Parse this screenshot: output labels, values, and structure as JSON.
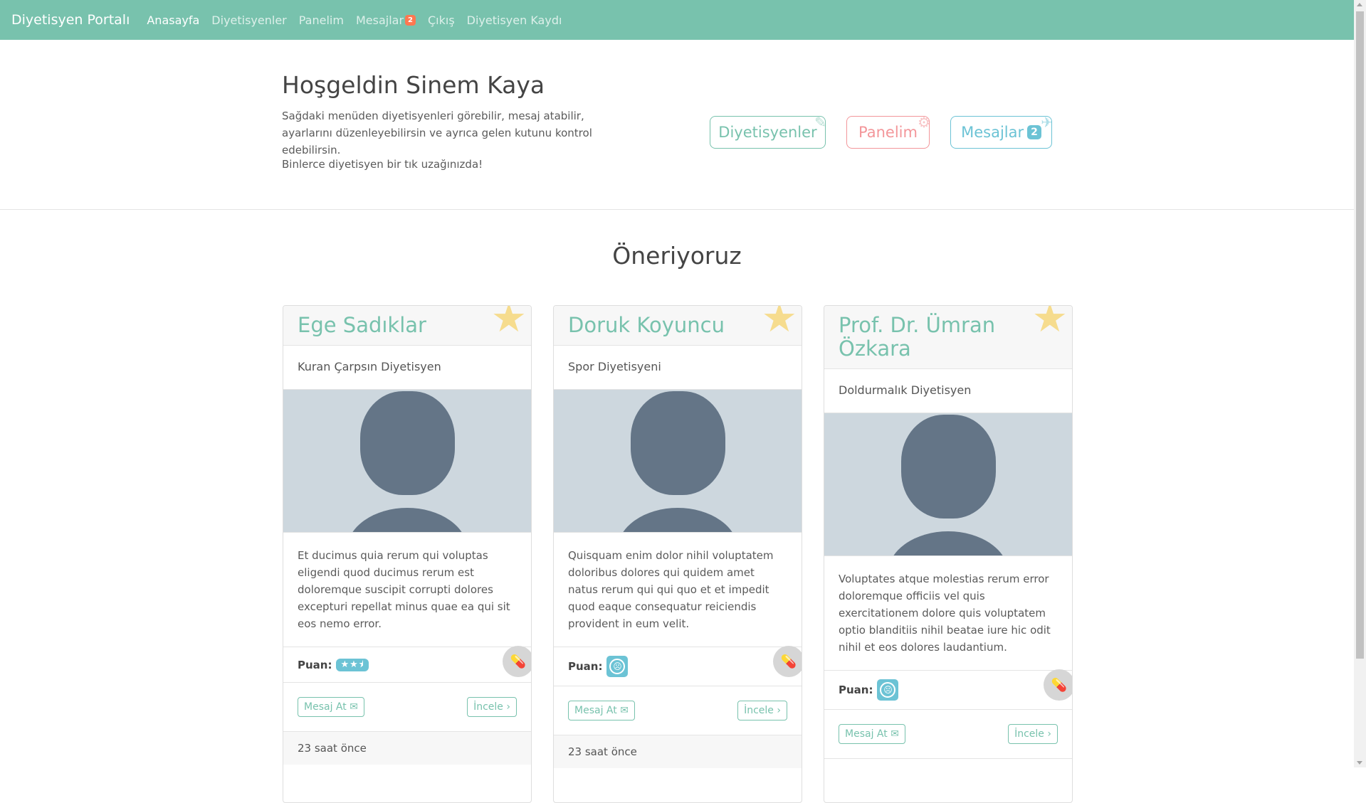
{
  "navbar": {
    "brand": "Diyetisyen Portalı",
    "links": [
      "Anasayfa",
      "Diyetisyenler",
      "Panelim",
      "Mesajlar",
      "Çıkış",
      "Diyetisyen Kaydı"
    ],
    "messages_badge": "2"
  },
  "welcome": {
    "title": "Hoşgeldin Sinem Kaya",
    "description": "Sağdaki menüden diyetisyenleri görebilir, mesaj atabilir, ayarlarını düzenleyebilirsin ve ayrıca gelen kutunu kontrol edebilirsin.",
    "tagline": "Binlerce diyetisyen bir tık uzağınızda!",
    "buttons": {
      "dietitians": "Diyetisyenler",
      "panel": "Panelim",
      "messages": "Mesajlar",
      "messages_badge": "2"
    }
  },
  "section": {
    "title": "Öneriyoruz"
  },
  "cards": [
    {
      "name": "Ege Sadıklar",
      "specialty": "Kuran Çarpsın Diyetisyen",
      "description": "Et ducimus quia rerum qui voluptas eligendi quod ducimus rerum est doloremque suscipit corrupti dolores excepturi repellat minus quae ea qui sit eos nemo error.",
      "rating_label": "Puan:",
      "rating": 2.5,
      "message_button": "Mesaj At",
      "view_button": "İncele",
      "time": "23 saat önce"
    },
    {
      "name": "Doruk Koyuncu",
      "specialty": "Spor Diyetisyeni",
      "description": "Quisquam enim dolor nihil voluptatem doloribus dolores qui quidem amet natus rerum qui qui quo et et impedit quod eaque consequatur reiciendis provident in eum velit.",
      "rating_label": "Puan:",
      "rating": 0,
      "message_button": "Mesaj At",
      "view_button": "İncele",
      "time": "23 saat önce"
    },
    {
      "name": "Prof. Dr. Ümran Özkara",
      "specialty": "Doldurmalık Diyetisyen",
      "description": "Voluptates atque molestias rerum error doloremque officiis vel quis exercitationem dolore quis voluptatem optio blanditiis nihil beatae iure hic odit nihil et eos dolores laudantium.",
      "rating_label": "Puan:",
      "rating": 0,
      "message_button": "Mesaj At",
      "view_button": "İncele"
    }
  ],
  "colors": {
    "primary": "#78c2ad",
    "secondary": "#f3969a",
    "info": "#6cc3d5",
    "star": "#f6dc8e",
    "avatar": "#647587"
  }
}
